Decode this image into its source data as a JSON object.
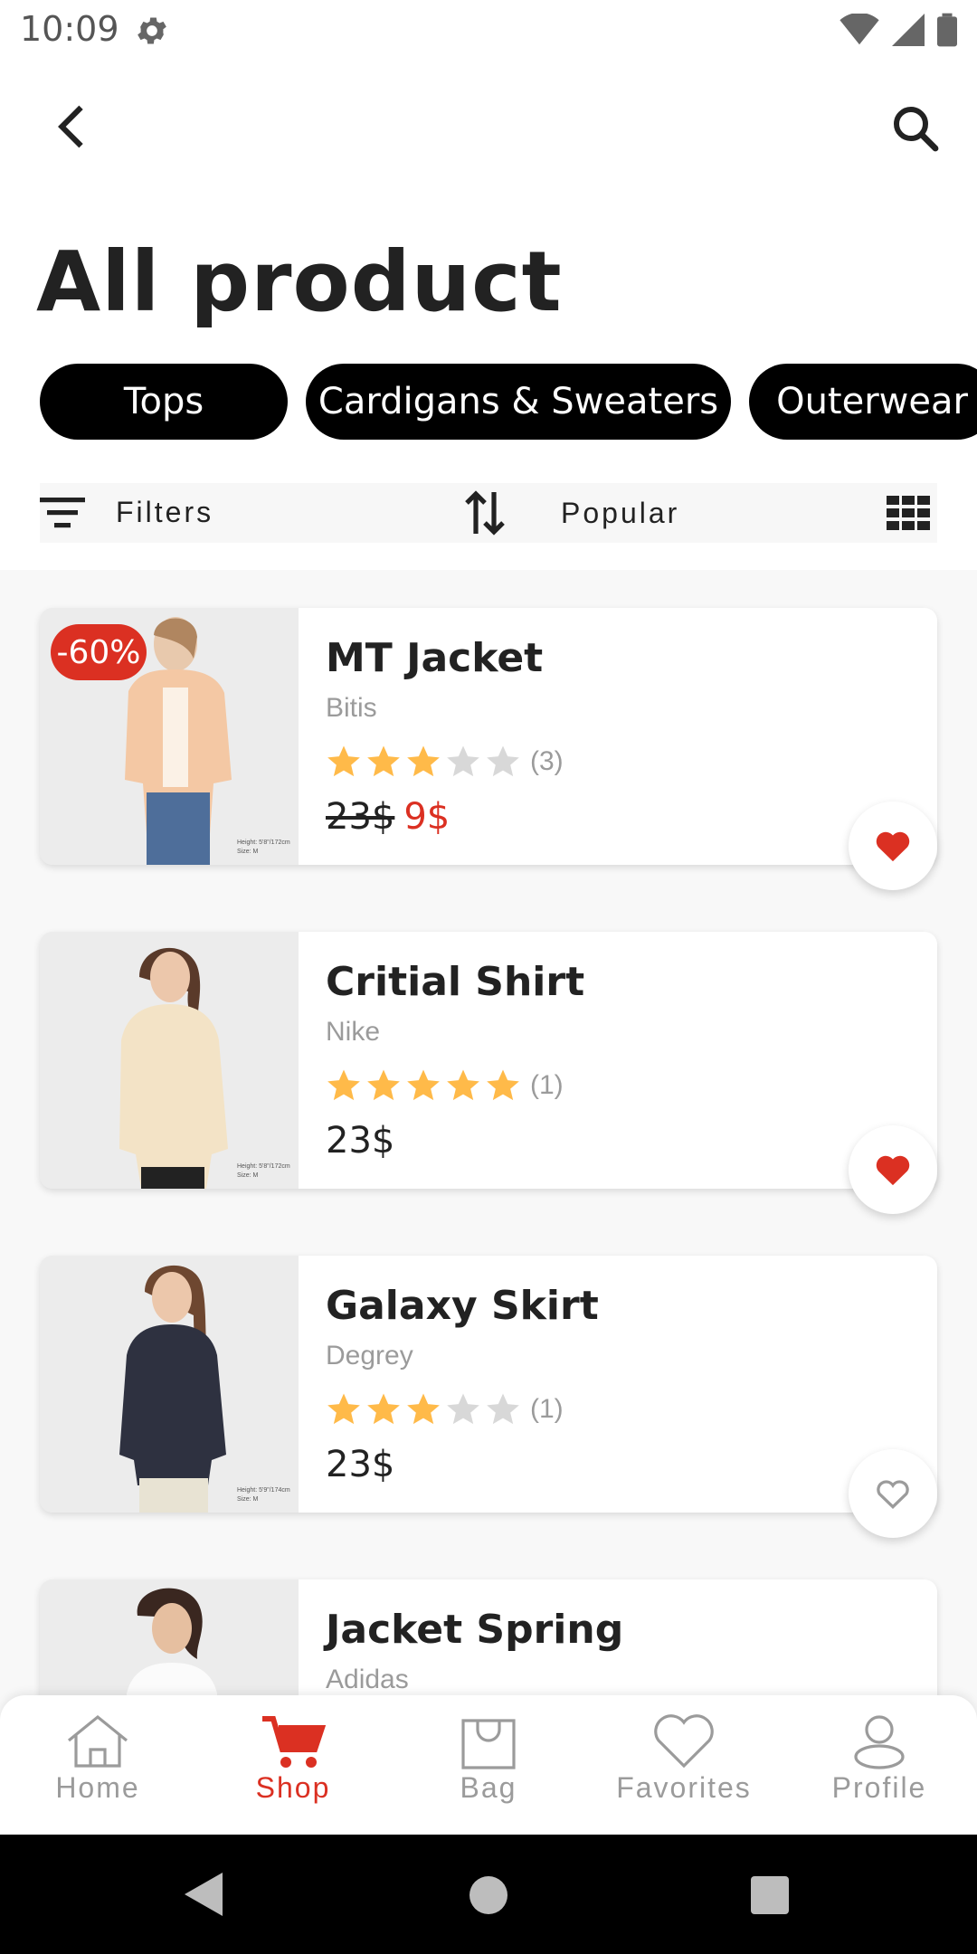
{
  "status_bar": {
    "time": "10:09",
    "icons": [
      "gear-icon",
      "wifi-icon",
      "signal-icon",
      "battery-icon"
    ]
  },
  "header": {
    "back_icon": "chevron-left-icon",
    "search_icon": "search-icon",
    "title": "All product"
  },
  "categories": [
    "Tops",
    "Cardigans & Sweaters",
    "Outerwear"
  ],
  "filter_bar": {
    "filters_label": "Filters",
    "sort_label": "Popular",
    "view_icon": "grid-view-icon"
  },
  "products": [
    {
      "name": "MT Jacket",
      "brand": "Bitis",
      "rating": 3,
      "reviews": "(3)",
      "old_price": "23$",
      "price": "9$",
      "discount": "-60%",
      "favorite": true,
      "photo_caption": "Height: 5'8\"/172cm Size: M"
    },
    {
      "name": "Critial Shirt",
      "brand": "Nike",
      "rating": 5,
      "reviews": "(1)",
      "price": "23$",
      "favorite": true,
      "photo_caption": "Height: 5'8\"/172cm Size: M"
    },
    {
      "name": "Galaxy Skirt",
      "brand": "Degrey",
      "rating": 3,
      "reviews": "(1)",
      "price": "23$",
      "favorite": false,
      "photo_caption": "Height: 5'9\"/174cm Size: M"
    },
    {
      "name": "Jacket Spring",
      "brand": "Adidas"
    }
  ],
  "bottom_nav": [
    {
      "label": "Home",
      "icon": "home-icon",
      "active": false
    },
    {
      "label": "Shop",
      "icon": "cart-icon",
      "active": true
    },
    {
      "label": "Bag",
      "icon": "bag-icon",
      "active": false
    },
    {
      "label": "Favorites",
      "icon": "heart-icon",
      "active": false
    },
    {
      "label": "Profile",
      "icon": "profile-icon",
      "active": false
    }
  ],
  "colors": {
    "accent": "#DB3022",
    "star": "#FFBA49",
    "star_empty": "#D8D8D8",
    "chip": "#000000"
  }
}
